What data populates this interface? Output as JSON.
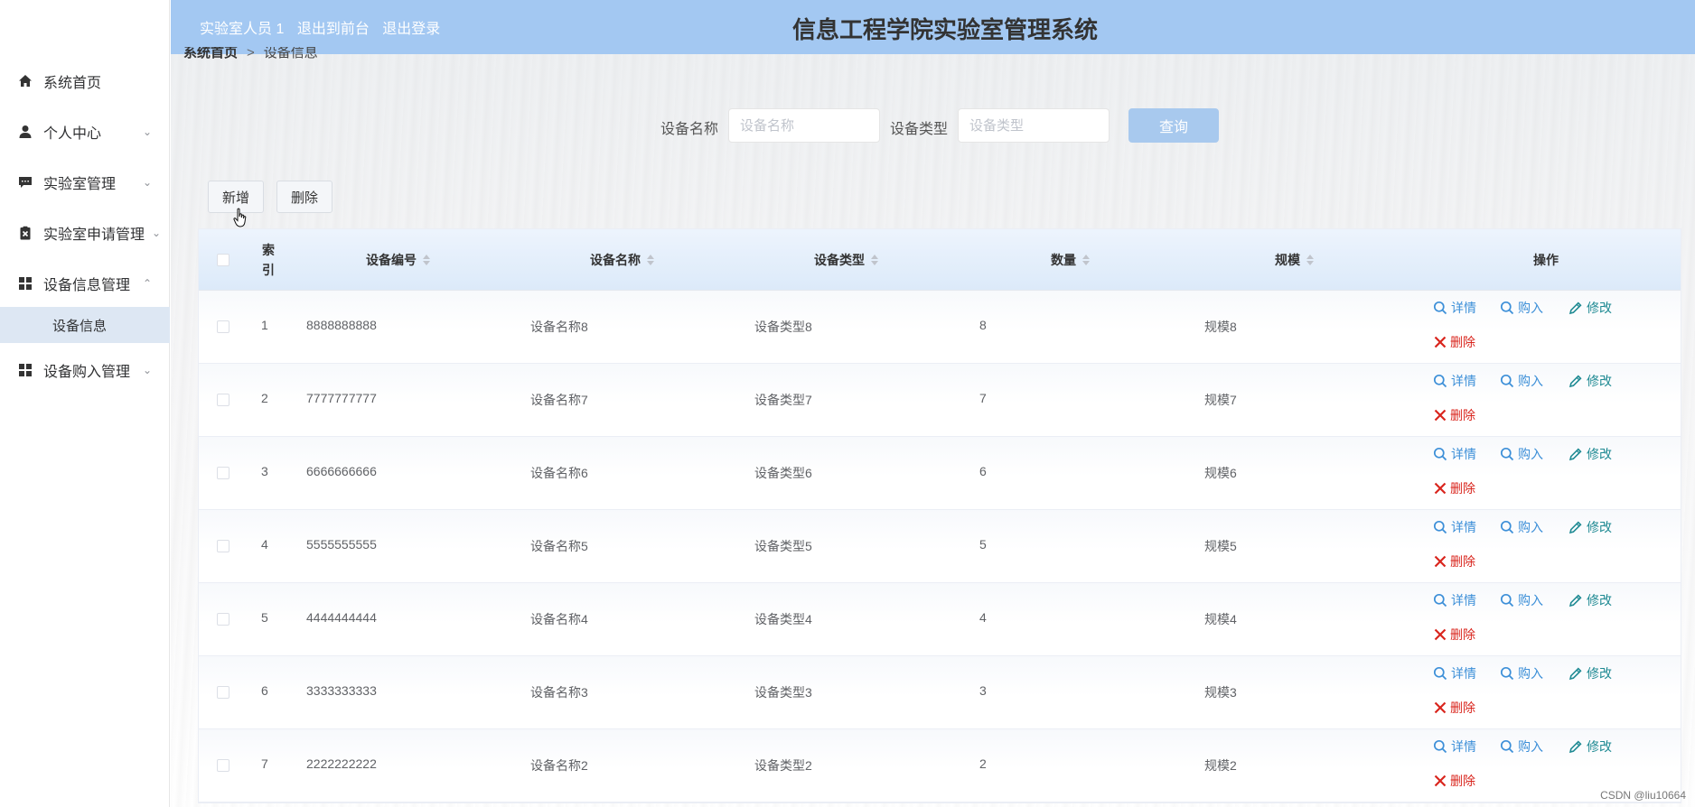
{
  "app": {
    "title": "信息工程学院实验室管理系统",
    "header_links": [
      "实验室人员 1",
      "退出到前台",
      "退出登录"
    ],
    "watermark": "CSDN @liu10664"
  },
  "sidebar": {
    "items": [
      {
        "label": "系统首页",
        "icon": "home-icon",
        "arrow": ""
      },
      {
        "label": "个人中心",
        "icon": "user-icon",
        "arrow": "chevron-down"
      },
      {
        "label": "实验室管理",
        "icon": "chat-icon",
        "arrow": "chevron-down"
      },
      {
        "label": "实验室申请管理",
        "icon": "clipboard-icon",
        "arrow": "chevron-down"
      },
      {
        "label": "设备信息管理",
        "icon": "grid-icon",
        "arrow": "chevron-up"
      },
      {
        "label": "设备购入管理",
        "icon": "grid-icon",
        "arrow": "chevron-down"
      }
    ],
    "active_sub": "设备信息"
  },
  "breadcrumb": [
    "系统首页",
    ">",
    "设备信息"
  ],
  "search": {
    "name_label": "设备名称",
    "name_placeholder": "设备名称",
    "type_label": "设备类型",
    "type_placeholder": "设备类型",
    "query_button": "查询"
  },
  "toolbar": {
    "add": "新增",
    "delete": "删除"
  },
  "table": {
    "headers": {
      "index": "索引",
      "code": "设备编号",
      "name": "设备名称",
      "type": "设备类型",
      "qty": "数量",
      "scale": "规模",
      "ops": "操作"
    },
    "ops": {
      "detail": "详情",
      "buy": "购入",
      "edit": "修改",
      "delete": "删除"
    },
    "rows": [
      {
        "index": "1",
        "code": "8888888888",
        "name": "设备名称8",
        "type": "设备类型8",
        "qty": "8",
        "scale": "规模8"
      },
      {
        "index": "2",
        "code": "7777777777",
        "name": "设备名称7",
        "type": "设备类型7",
        "qty": "7",
        "scale": "规模7"
      },
      {
        "index": "3",
        "code": "6666666666",
        "name": "设备名称6",
        "type": "设备类型6",
        "qty": "6",
        "scale": "规模6"
      },
      {
        "index": "4",
        "code": "5555555555",
        "name": "设备名称5",
        "type": "设备类型5",
        "qty": "5",
        "scale": "规模5"
      },
      {
        "index": "5",
        "code": "4444444444",
        "name": "设备名称4",
        "type": "设备类型4",
        "qty": "4",
        "scale": "规模4"
      },
      {
        "index": "6",
        "code": "3333333333",
        "name": "设备名称3",
        "type": "设备类型3",
        "qty": "3",
        "scale": "规模3"
      },
      {
        "index": "7",
        "code": "2222222222",
        "name": "设备名称2",
        "type": "设备类型2",
        "qty": "2",
        "scale": "规模2"
      }
    ]
  },
  "colors": {
    "header_bg": "#a3c8f2",
    "accent_blue": "#3c8fd8",
    "delete_red": "#d9251d",
    "edit_teal": "#1f8a93",
    "active_sub_bg": "#dde7f3"
  }
}
